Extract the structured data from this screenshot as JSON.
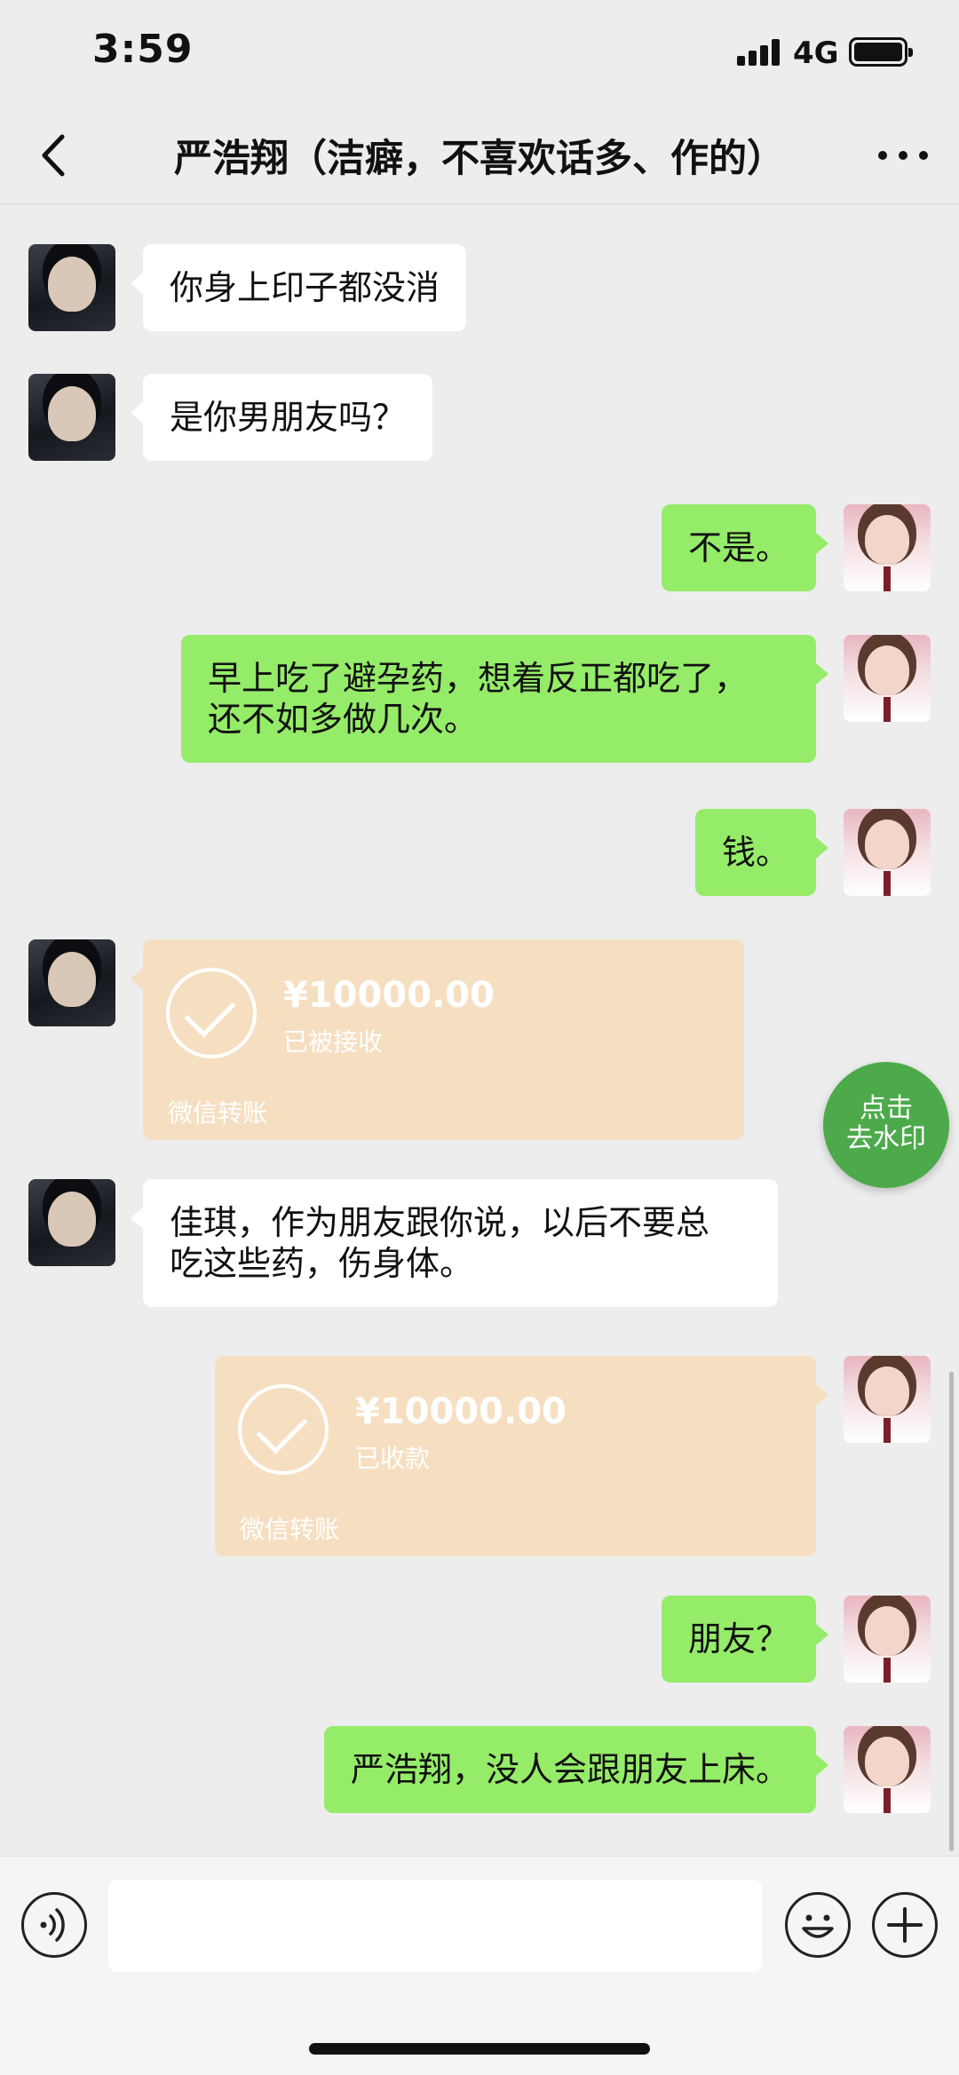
{
  "status_bar": {
    "time": "3:59",
    "network": "4G"
  },
  "nav": {
    "title": "严浩翔（洁癖，不喜欢话多、作的）"
  },
  "messages": [
    {
      "side": "left",
      "text": "你身上印子都没消"
    },
    {
      "side": "left",
      "text": "是你男朋友吗？"
    },
    {
      "side": "right",
      "text": "不是。"
    },
    {
      "side": "right",
      "line1": "早上吃了避孕药，想着反正都吃了，",
      "line2": "还不如多做几次。"
    },
    {
      "side": "right",
      "text": "钱。"
    },
    {
      "side": "left",
      "type": "transfer",
      "amount": "¥10000.00",
      "status": "已被接收",
      "footer": "微信转账"
    },
    {
      "side": "left",
      "line1": "佳琪，作为朋友跟你说，以后不要总",
      "line2": "吃这些药，伤身体。"
    },
    {
      "side": "right",
      "type": "transfer",
      "amount": "¥10000.00",
      "status": "已收款",
      "footer": "微信转账"
    },
    {
      "side": "right",
      "text": "朋友？"
    },
    {
      "side": "right",
      "text": "严浩翔，没人会跟朋友上床。"
    }
  ],
  "watermark_button": {
    "line1": "点击",
    "line2": "去水印"
  },
  "icons": {
    "back": "chevron-left-icon",
    "more": "ellipsis-icon",
    "voice": "voice-icon",
    "emoji": "emoji-icon",
    "plus": "plus-icon"
  }
}
